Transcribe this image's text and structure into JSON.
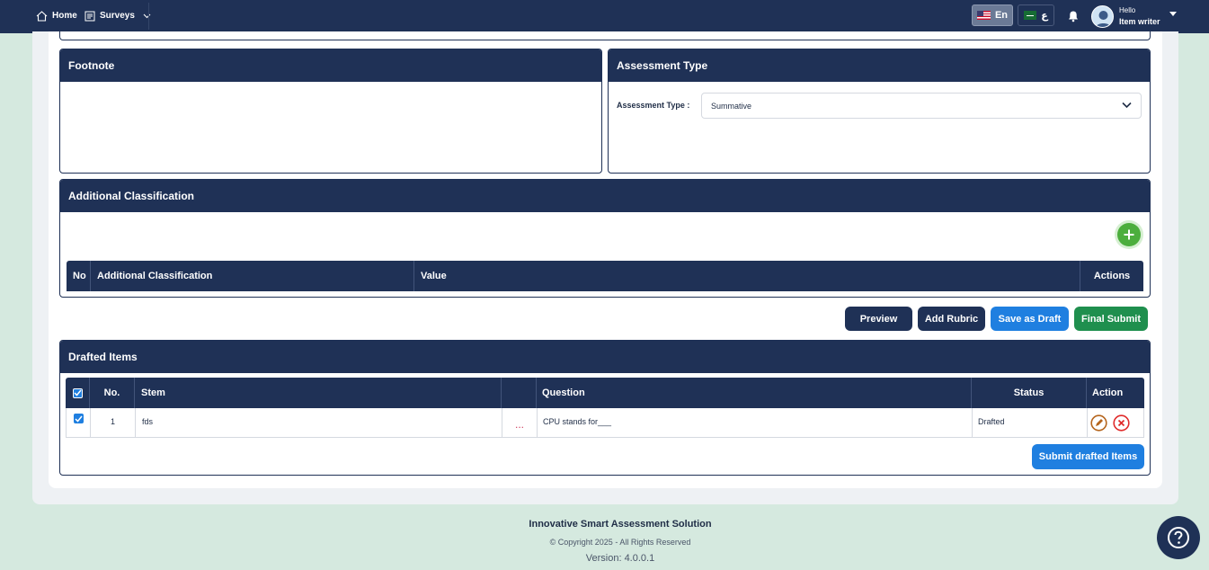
{
  "nav": {
    "home_label": "Home",
    "surveys_label": "Surveys",
    "lang_en": "En",
    "lang_ar": "ع",
    "greeting": "Hello",
    "user_name": "Item writer"
  },
  "footnote_panel": {
    "title": "Footnote"
  },
  "assessment_type_panel": {
    "title": "Assessment Type",
    "field_label": "Assessment Type :",
    "selected_value": "Summative"
  },
  "additional_classification": {
    "title": "Additional Classification",
    "columns": [
      "No",
      "Additional Classification",
      "Value",
      "Actions"
    ]
  },
  "buttons": {
    "preview": "Preview",
    "add_rubric": "Add Rubric",
    "save_as_draft": "Save as Draft",
    "final_submit": "Final Submit"
  },
  "drafted_items": {
    "title": "Drafted Items",
    "columns": [
      "No.",
      "Stem",
      "",
      "Question",
      "Status",
      "Action"
    ],
    "rows": [
      {
        "checked": true,
        "no": "1",
        "stem": "fds",
        "dots": "...",
        "question": "CPU stands for___",
        "status": "Drafted"
      }
    ],
    "submit_label": "Submit drafted Items"
  },
  "footer": {
    "title": "Innovative Smart Assessment Solution",
    "copyright": "© Copyright 2025 - All Rights Reserved",
    "version": "Version: 4.0.0.1"
  },
  "colors": {
    "navy": "#1f3156",
    "blue": "#1f7fe0",
    "green": "#1f8f4e",
    "add_green": "#4cae3d",
    "background": "#d5e9df"
  },
  "icons": {
    "home": "home-icon",
    "surveys": "survey-icon",
    "bell": "bell-icon",
    "add": "plus-icon",
    "edit": "edit-icon",
    "delete": "delete-icon",
    "help": "help-icon"
  }
}
